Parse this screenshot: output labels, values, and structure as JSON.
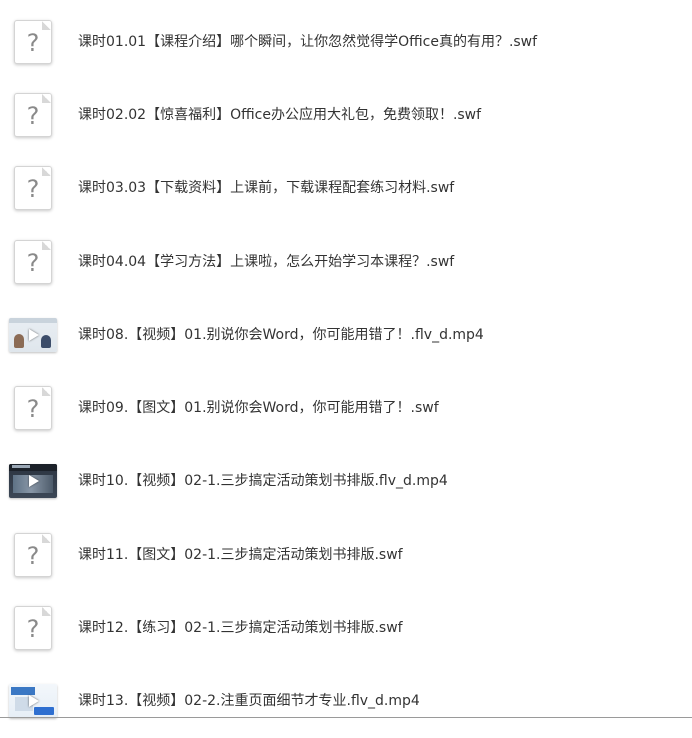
{
  "files": [
    {
      "name": "课时01.01【课程介绍】哪个瞬间，让你忽然觉得学Office真的有用？.swf",
      "icon": "unknown-file-icon",
      "type": "swf"
    },
    {
      "name": "课时02.02【惊喜福利】Office办公应用大礼包，免费领取！.swf",
      "icon": "unknown-file-icon",
      "type": "swf"
    },
    {
      "name": "课时03.03【下载资料】上课前，下载课程配套练习材料.swf",
      "icon": "unknown-file-icon",
      "type": "swf"
    },
    {
      "name": "课时04.04【学习方法】上课啦，怎么开始学习本课程？.swf",
      "icon": "unknown-file-icon",
      "type": "swf"
    },
    {
      "name": "课时08.【视频】01.别说你会Word，你可能用错了！.flv_d.mp4",
      "icon": "video-thumbnail-icon",
      "type": "mp4",
      "thumb": "light"
    },
    {
      "name": "课时09.【图文】01.别说你会Word，你可能用错了！.swf",
      "icon": "unknown-file-icon",
      "type": "swf"
    },
    {
      "name": "课时10.【视频】02-1.三步搞定活动策划书排版.flv_d.mp4",
      "icon": "video-thumbnail-icon",
      "type": "mp4",
      "thumb": "dark"
    },
    {
      "name": "课时11.【图文】02-1.三步搞定活动策划书排版.swf",
      "icon": "unknown-file-icon",
      "type": "swf"
    },
    {
      "name": "课时12.【练习】02-1.三步搞定活动策划书排版.swf",
      "icon": "unknown-file-icon",
      "type": "swf"
    },
    {
      "name": "课时13.【视频】02-2.注重页面细节才专业.flv_d.mp4",
      "icon": "video-thumbnail-icon",
      "type": "mp4",
      "thumb": "blue"
    }
  ],
  "colors": {
    "text": "#333333",
    "background": "#ffffff",
    "icon_border": "#d4d4d4",
    "question_mark": "#8a8a8a"
  }
}
